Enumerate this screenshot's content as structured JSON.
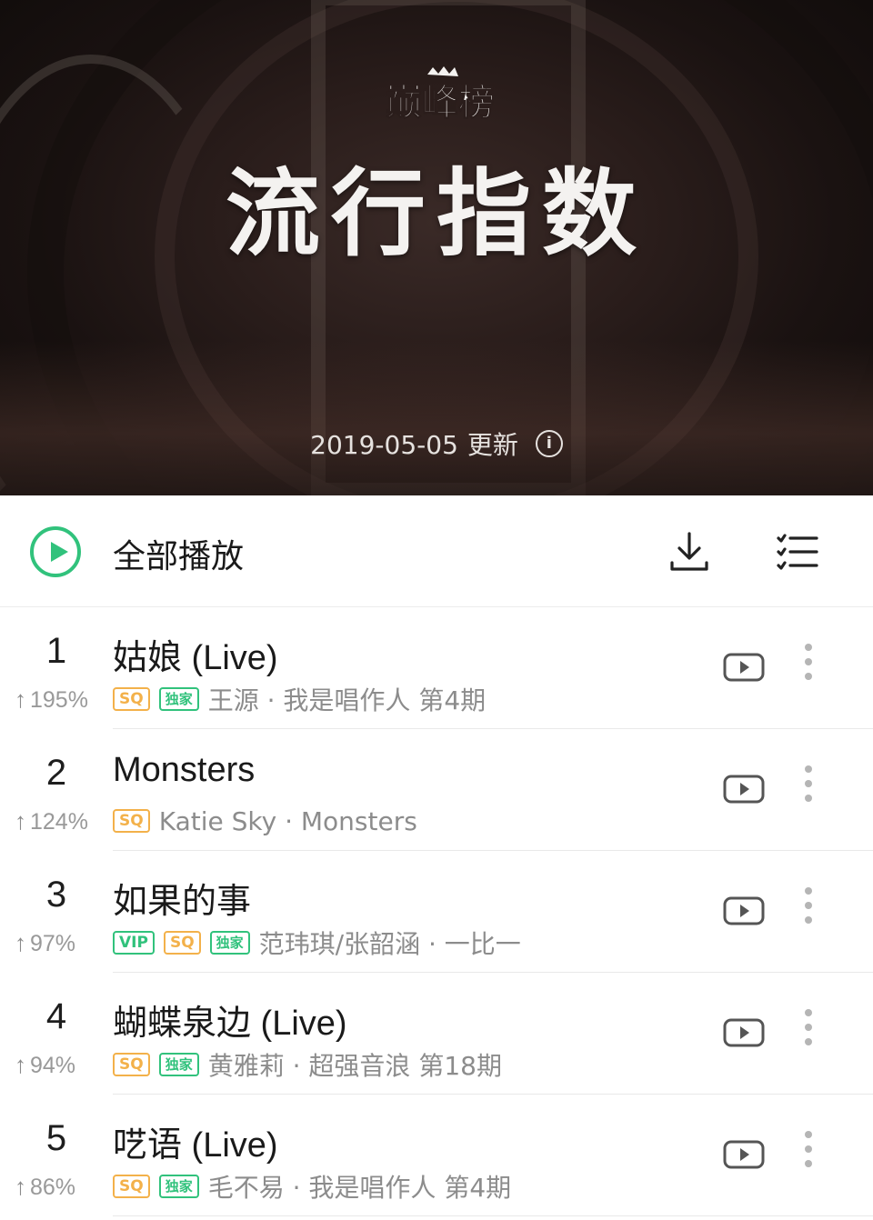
{
  "banner": {
    "brand_label": "巅峰榜",
    "title": "流行指数",
    "updated_date": "2019-05-05",
    "updated_suffix": "更新",
    "info_icon": "info-icon"
  },
  "toolbar": {
    "play_all_label": "全部播放",
    "play_icon": "play-circle-icon",
    "download_icon": "download-icon",
    "list_icon": "list-select-icon"
  },
  "colors": {
    "accent_green": "#31c27c",
    "sq_orange": "#f3b14a"
  },
  "songs": [
    {
      "rank": "1",
      "trend": "195%",
      "title": "姑娘 (Live)",
      "tags": [
        "SQ",
        "独家"
      ],
      "artist_album": "王源 · 我是唱作人 第4期"
    },
    {
      "rank": "2",
      "trend": "124%",
      "title": "Monsters",
      "tags": [
        "SQ"
      ],
      "artist_album": "Katie Sky · Monsters"
    },
    {
      "rank": "3",
      "trend": "97%",
      "title": "如果的事",
      "tags": [
        "VIP",
        "SQ",
        "独家"
      ],
      "artist_album": "范玮琪/张韶涵 · 一比一"
    },
    {
      "rank": "4",
      "trend": "94%",
      "title": "蝴蝶泉边 (Live)",
      "tags": [
        "SQ",
        "独家"
      ],
      "artist_album": "黄雅莉 · 超强音浪 第18期"
    },
    {
      "rank": "5",
      "trend": "86%",
      "title": "呓语 (Live)",
      "tags": [
        "SQ",
        "独家"
      ],
      "artist_album": "毛不易 · 我是唱作人 第4期"
    }
  ]
}
